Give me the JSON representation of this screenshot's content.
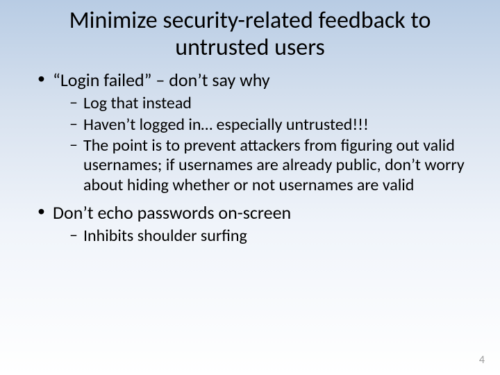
{
  "title": "Minimize security-related feedback to untrusted users",
  "bullets": [
    {
      "text": "“Login failed” – don’t say why",
      "sub": [
        "Log that instead",
        "Haven’t logged in… especially untrusted!!!",
        "The point is to prevent attackers from figuring out valid usernames; if usernames are already public, don’t worry about hiding whether or not usernames are valid"
      ]
    },
    {
      "text": "Don’t echo passwords on-screen",
      "sub": [
        "Inhibits shoulder surfing"
      ]
    }
  ],
  "page_number": "4"
}
